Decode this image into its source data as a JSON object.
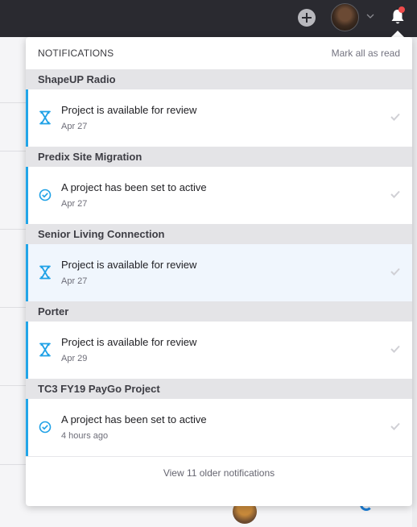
{
  "topbar": {
    "add_icon": "plus-circle-icon",
    "avatar_icon": "user-avatar",
    "chevron_icon": "chevron-down-icon",
    "bell_icon": "bell-icon",
    "bell_badge_color": "#ef4b4b"
  },
  "notifications": {
    "title": "NOTIFICATIONS",
    "mark_all": "Mark all as read",
    "footer": "View 11 older notifications",
    "accent_color": "#22a5e8",
    "groups": [
      {
        "project": "ShapeUP Radio",
        "item": {
          "icon": "hourglass-icon",
          "text": "Project is available for review",
          "date": "Apr 27"
        }
      },
      {
        "project": "Predix Site Migration",
        "item": {
          "icon": "check-circle-icon",
          "text": "A project has been set to active",
          "date": "Apr 27"
        }
      },
      {
        "project": "Senior Living Connection",
        "item": {
          "icon": "hourglass-icon",
          "text": "Project is available for review",
          "date": "Apr 27"
        }
      },
      {
        "project": "Porter",
        "item": {
          "icon": "hourglass-icon",
          "text": "Project is available for review",
          "date": "Apr 29"
        }
      },
      {
        "project": "TC3 FY19 PayGo Project",
        "item": {
          "icon": "check-circle-icon",
          "text": "A project has been set to active",
          "date": "4 hours ago"
        }
      }
    ]
  }
}
